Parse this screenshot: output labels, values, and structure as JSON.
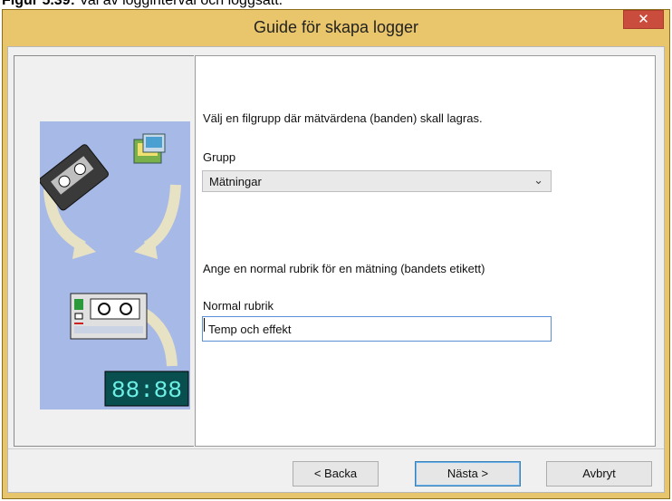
{
  "doc_caption": {
    "bold": "Figur 5.39:",
    "text": " Val av logginterval och loggsätt."
  },
  "window": {
    "title": "Guide för skapa logger",
    "close_glyph": "✕"
  },
  "content": {
    "instruction1": "Välj en filgrupp där mätvärdena (banden) skall lagras.",
    "group_label": "Grupp",
    "group_value": "Mätningar",
    "instruction2": "Ange en normal rubrik för en mätning (bandets etikett)",
    "normal_label": "Normal rubrik",
    "normal_value": "Temp och effekt"
  },
  "illustration": {
    "clock_text": "88:88"
  },
  "buttons": {
    "back": "< Backa",
    "next": "Nästa >",
    "cancel": "Avbryt"
  },
  "colors": {
    "titlebar": "#e9c66b",
    "close": "#c94c3c",
    "illustration_bg": "#a7b9e6",
    "focus": "#5b8fd6"
  }
}
